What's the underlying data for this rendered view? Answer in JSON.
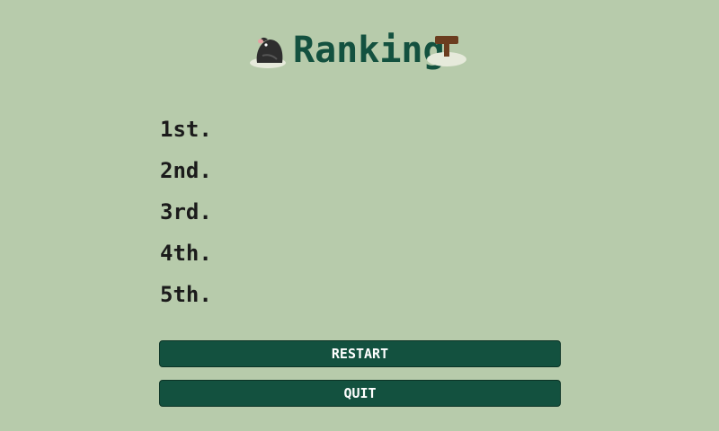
{
  "title": {
    "text": "Ranking",
    "left_icon": "mole-icon",
    "right_icon": "hammer-in-hole-icon"
  },
  "ranking": [
    {
      "place": "1st."
    },
    {
      "place": "2nd."
    },
    {
      "place": "3rd."
    },
    {
      "place": "4th."
    },
    {
      "place": "5th."
    }
  ],
  "buttons": {
    "restart": "RESTART",
    "quit": "QUIT"
  },
  "colors": {
    "background": "#b7cbab",
    "accent": "#13513f",
    "text": "#1b1b1b",
    "button_text": "#ffffff"
  }
}
